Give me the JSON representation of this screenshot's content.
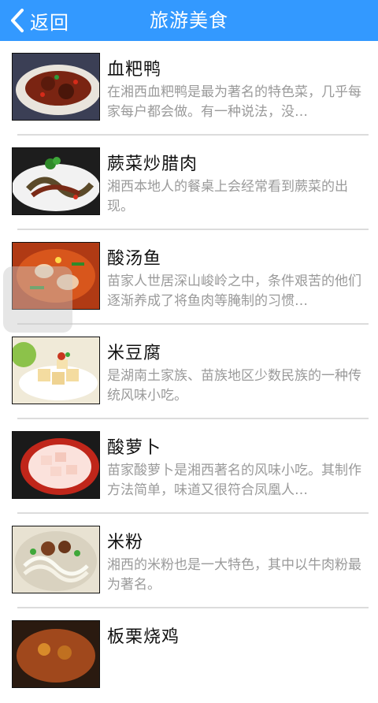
{
  "header": {
    "back_label": "返回",
    "title": "旅游美食",
    "color": "#3399ff"
  },
  "items": [
    {
      "name": "血粑鸭",
      "desc": "在湘西血粑鸭是最为著名的特色菜，几乎每家每户都会做。有一种说法，没…",
      "icon": "duck-dish-photo"
    },
    {
      "name": "蕨菜炒腊肉",
      "desc": "湘西本地人的餐桌上会经常看到蕨菜的出现。",
      "icon": "fern-bacon-photo"
    },
    {
      "name": "酸汤鱼",
      "desc": "苗家人世居深山峻岭之中，条件艰苦的他们逐渐养成了将鱼肉等腌制的习惯…",
      "icon": "sour-fish-photo"
    },
    {
      "name": "米豆腐",
      "desc": "是湖南土家族、苗族地区少数民族的一种传统风味小吃。",
      "icon": "rice-tofu-photo"
    },
    {
      "name": "酸萝卜",
      "desc": "苗家酸萝卜是湘西著名的风味小吃。其制作方法简单，味道又很符合凤凰人…",
      "icon": "pickled-radish-photo"
    },
    {
      "name": "米粉",
      "desc": "湘西的米粉也是一大特色，其中以牛肉粉最为著名。",
      "icon": "rice-noodles-photo"
    },
    {
      "name": "板栗烧鸡",
      "desc": "",
      "icon": "chestnut-chicken-photo"
    }
  ]
}
